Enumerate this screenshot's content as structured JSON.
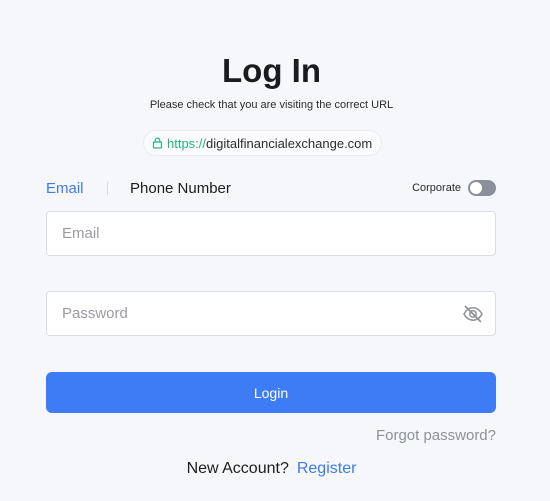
{
  "title": "Log In",
  "subtitle": "Please check that you are visiting the correct URL",
  "url": {
    "protocol": "https://",
    "domain": "digitalfinancialexchange.com",
    "icon": "lock-icon"
  },
  "tabs": {
    "email": "Email",
    "phone": "Phone Number"
  },
  "corporate": {
    "label": "Corporate",
    "enabled": false
  },
  "email_field": {
    "placeholder": "Email",
    "value": ""
  },
  "password_field": {
    "placeholder": "Password",
    "value": "",
    "icon": "eye-off-icon"
  },
  "login_button": "Login",
  "forgot_password": "Forgot password?",
  "register": {
    "question": "New Account?",
    "link": "Register"
  },
  "colors": {
    "accent": "#3e7cf6",
    "link": "#3f7be8",
    "secure": "#24b47e",
    "background": "#f6f7fb"
  }
}
